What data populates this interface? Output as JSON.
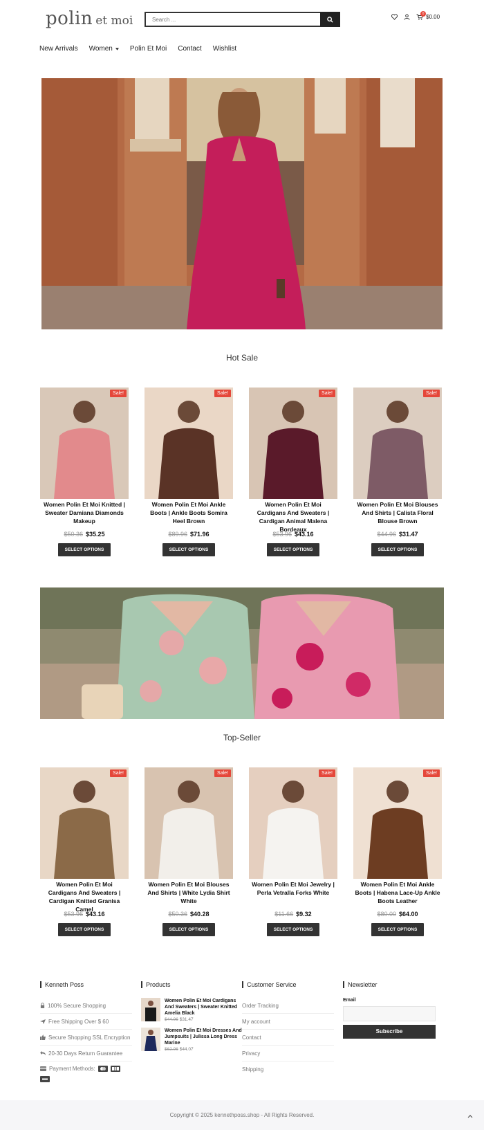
{
  "header": {
    "logo_main": "polin",
    "logo_sub": "et moi",
    "search_placeholder": "Search ...",
    "cart_count": "0",
    "cart_total": "$0.00"
  },
  "nav": [
    "New Arrivals",
    "Women",
    "Polin Et Moi",
    "Contact",
    "Wishlist"
  ],
  "hot_sale": {
    "title": "Hot Sale",
    "products": [
      {
        "name": "Women Polin Et Moi Knitted | Sweater Damiana Diamonds Makeup",
        "old": "$50.36",
        "new": "$35.25",
        "badge": "Sale!",
        "button": "SELECT OPTIONS",
        "bg": "#d9c8b8",
        "fg": "#e28a8c"
      },
      {
        "name": "Women Polin Et Moi Ankle Boots | Ankle Boots Somira Heel Brown",
        "old": "$89.96",
        "new": "$71.96",
        "badge": "Sale!",
        "button": "SELECT OPTIONS",
        "bg": "#ead7c6",
        "fg": "#5a3326"
      },
      {
        "name": "Women Polin Et Moi Cardigans And Sweaters | Cardigan Animal Malena Bordeaux",
        "old": "$53.96",
        "new": "$43.16",
        "badge": "Sale!",
        "button": "SELECT OPTIONS",
        "bg": "#d8c5b4",
        "fg": "#5a1a2a"
      },
      {
        "name": "Women Polin Et Moi Blouses And Shirts | Calista Floral Blouse Brown",
        "old": "$44.96",
        "new": "$31.47",
        "badge": "Sale!",
        "button": "SELECT OPTIONS",
        "bg": "#dccdc0",
        "fg": "#7e5b66"
      }
    ]
  },
  "top_seller": {
    "title": "Top-Seller",
    "products": [
      {
        "name": "Women Polin Et Moi Cardigans And Sweaters | Cardigan Knitted Granisa Camel",
        "old": "$53.96",
        "new": "$43.16",
        "badge": "Sale!",
        "button": "SELECT OPTIONS",
        "bg": "#e8d7c6",
        "fg": "#8b6a48"
      },
      {
        "name": "Women Polin Et Moi Blouses And Shirts | White Lydia Shirt White",
        "old": "$50.36",
        "new": "$40.28",
        "badge": "Sale!",
        "button": "SELECT OPTIONS",
        "bg": "#d8c3b0",
        "fg": "#f2efea"
      },
      {
        "name": "Women Polin Et Moi Jewelry | Perla Vetralla Forks White",
        "old": "$11.66",
        "new": "$9.32",
        "badge": "Sale!",
        "button": "SELECT OPTIONS",
        "bg": "#e5cfbf",
        "fg": "#f5f3f0"
      },
      {
        "name": "Women Polin Et Moi Ankle Boots | Habena Lace-Up Ankle Boots Leather",
        "old": "$80.00",
        "new": "$64.00",
        "badge": "Sale!",
        "button": "SELECT OPTIONS",
        "bg": "#efe0d2",
        "fg": "#6d3d22"
      }
    ]
  },
  "footer": {
    "col1_title": "Kenneth Poss",
    "features": [
      "100% Secure Shopping",
      "Free Shipping Over $ 60",
      "Secure Shopping SSL Encryption",
      "20-30 Days Return Guarantee",
      "Payment Methods:"
    ],
    "col2_title": "Products",
    "mini_products": [
      {
        "title": "Women Polin Et Moi Cardigans And Sweaters | Sweater Knitted Amelia Black",
        "old": "$44.96",
        "new": "$31.47"
      },
      {
        "title": "Women Polin Et Moi Dresses And Jumpsuits | Julissa Long Dress Marine",
        "old": "$62.96",
        "new": "$44.07"
      }
    ],
    "col3_title": "Customer Service",
    "links": [
      "Order Tracking",
      "My account",
      "Contact",
      "Privacy",
      "Shipping"
    ],
    "col4_title": "Newsletter",
    "email_label": "Email",
    "subscribe": "Subscribe",
    "copyright": "Copyright © 2025 kennethposs.shop - All Rights Reserved."
  }
}
